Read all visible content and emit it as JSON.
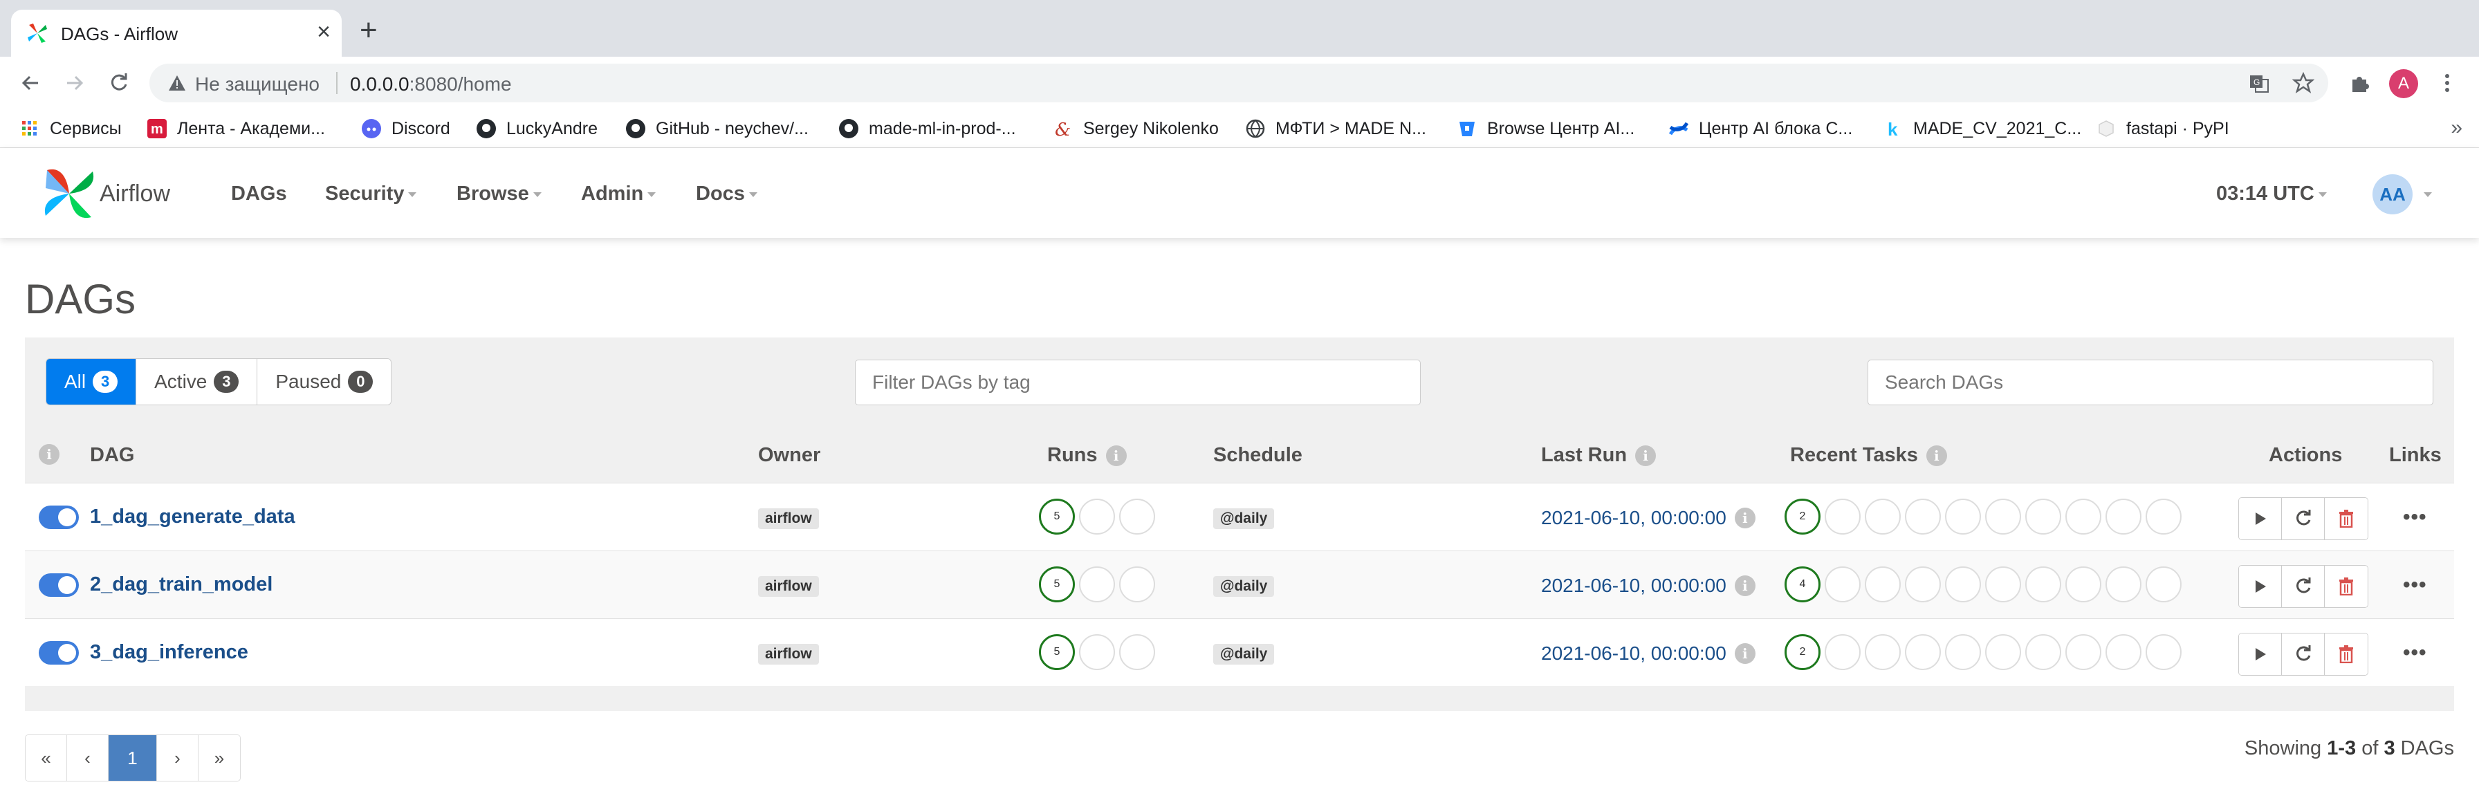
{
  "browser": {
    "tab_title": "DAGs - Airflow",
    "security_label": "Не защищено",
    "url_host": "0.0.0.0",
    "url_path": ":8080/home",
    "profile_initial": "A",
    "bookmarks": [
      {
        "label": "Сервисы",
        "icon": "apps-grid-icon"
      },
      {
        "label": "Лента - Академи...",
        "icon": "lenta-icon"
      },
      {
        "label": "Discord",
        "icon": "discord-icon"
      },
      {
        "label": "LuckyAndre",
        "icon": "github-icon"
      },
      {
        "label": "GitHub - neychev/...",
        "icon": "github-icon"
      },
      {
        "label": "made-ml-in-prod-...",
        "icon": "github-icon"
      },
      {
        "label": "Sergey Nikolenko",
        "icon": "nikolenko-icon"
      },
      {
        "label": "МФТИ > MADE N...",
        "icon": "globe-icon"
      },
      {
        "label": "Browse Центр AI...",
        "icon": "bitbucket-icon"
      },
      {
        "label": "Центр AI блока С...",
        "icon": "confluence-icon"
      },
      {
        "label": "MADE_CV_2021_C...",
        "icon": "kaggle-icon"
      },
      {
        "label": "fastapi · PyPI",
        "icon": "pypi-icon"
      }
    ],
    "bookmarks_more": "»"
  },
  "navbar": {
    "brand": "Airflow",
    "items": [
      "DAGs",
      "Security",
      "Browse",
      "Admin",
      "Docs"
    ],
    "clock": "03:14 UTC",
    "user_initials": "AA"
  },
  "page": {
    "title": "DAGs",
    "filters": [
      {
        "label": "All",
        "count": "3",
        "active": true
      },
      {
        "label": "Active",
        "count": "3",
        "active": false
      },
      {
        "label": "Paused",
        "count": "0",
        "active": false
      }
    ],
    "tag_filter_placeholder": "Filter DAGs by tag",
    "search_placeholder": "Search DAGs",
    "columns": {
      "dag": "DAG",
      "owner": "Owner",
      "runs": "Runs",
      "schedule": "Schedule",
      "last_run": "Last Run",
      "recent_tasks": "Recent Tasks",
      "actions": "Actions",
      "links": "Links"
    },
    "info_glyph": "i",
    "rows": [
      {
        "dag_id": "1_dag_generate_data",
        "owner": "airflow",
        "runs_success": "5",
        "schedule": "@daily",
        "last_run": "2021-06-10, 00:00:00",
        "recent_success": "2"
      },
      {
        "dag_id": "2_dag_train_model",
        "owner": "airflow",
        "runs_success": "5",
        "schedule": "@daily",
        "last_run": "2021-06-10, 00:00:00",
        "recent_success": "4"
      },
      {
        "dag_id": "3_dag_inference",
        "owner": "airflow",
        "runs_success": "5",
        "schedule": "@daily",
        "last_run": "2021-06-10, 00:00:00",
        "recent_success": "2"
      }
    ],
    "links_glyph": "•••",
    "pagination": {
      "first": "«",
      "prev": "‹",
      "current": "1",
      "next": "›",
      "last": "»"
    },
    "showing": {
      "prefix": "Showing ",
      "range": "1-3",
      "middle": " of ",
      "total": "3",
      "suffix": " DAGs"
    }
  },
  "colors": {
    "accent": "#017cee",
    "dag_link": "#1b4f8a",
    "success_ring": "#1e7a1e",
    "delete": "#d9534f"
  }
}
